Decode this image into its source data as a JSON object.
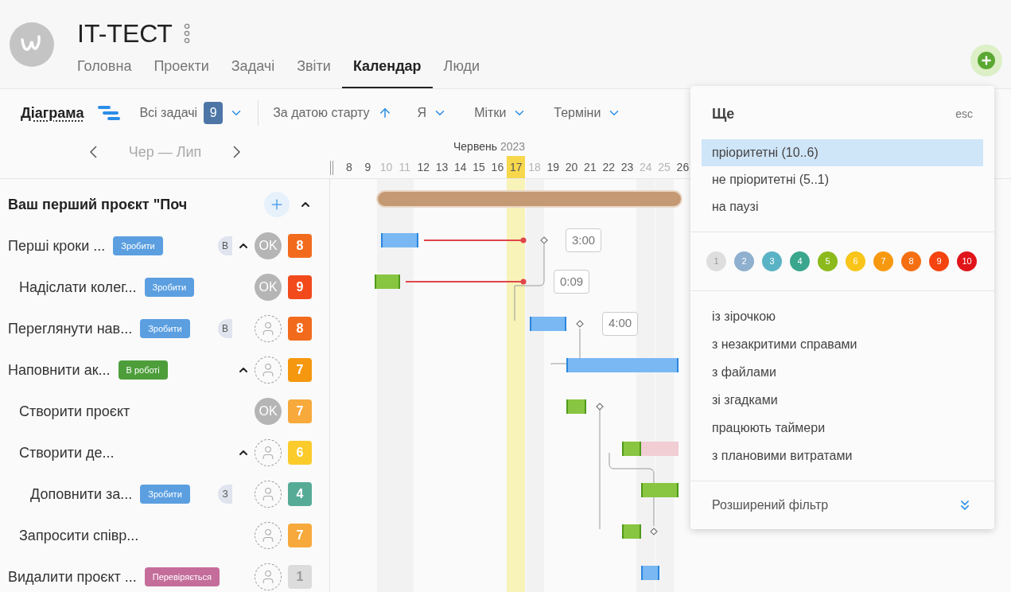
{
  "header": {
    "title": "IT-ТЕСТ",
    "nav": [
      {
        "label": "Головна",
        "selected": false
      },
      {
        "label": "Проекти",
        "selected": false
      },
      {
        "label": "Задачі",
        "selected": false
      },
      {
        "label": "Звіти",
        "selected": false
      },
      {
        "label": "Календар",
        "selected": true
      },
      {
        "label": "Люди",
        "selected": false
      }
    ]
  },
  "toolbar": {
    "view": {
      "label": "Діаграма",
      "selected": true
    },
    "filter": "Всі задачі",
    "count": "9",
    "sort": "За датою старту",
    "user": "Я",
    "labels": "Мітки",
    "deadlines": "Терміни"
  },
  "timeline": {
    "range": "Чер — Лип",
    "month": "Червень",
    "year": "2023",
    "days": [
      {
        "label": "8",
        "weekend": false,
        "today": false
      },
      {
        "label": "9",
        "weekend": false,
        "today": false
      },
      {
        "label": "10",
        "weekend": true,
        "today": false
      },
      {
        "label": "11",
        "weekend": true,
        "today": false
      },
      {
        "label": "12",
        "weekend": false,
        "today": false
      },
      {
        "label": "13",
        "weekend": false,
        "today": false
      },
      {
        "label": "14",
        "weekend": false,
        "today": false
      },
      {
        "label": "15",
        "weekend": false,
        "today": false
      },
      {
        "label": "16",
        "weekend": false,
        "today": false
      },
      {
        "label": "17",
        "weekend": false,
        "today": true
      },
      {
        "label": "18",
        "weekend": true,
        "today": false
      },
      {
        "label": "19",
        "weekend": false,
        "today": false
      },
      {
        "label": "20",
        "weekend": false,
        "today": false
      },
      {
        "label": "21",
        "weekend": false,
        "today": false
      },
      {
        "label": "22",
        "weekend": false,
        "today": false
      },
      {
        "label": "23",
        "weekend": false,
        "today": false
      },
      {
        "label": "24",
        "weekend": true,
        "today": false
      },
      {
        "label": "25",
        "weekend": true,
        "today": false
      },
      {
        "label": "26",
        "weekend": false,
        "today": false
      }
    ]
  },
  "project": {
    "name": "Ваш перший проєкт \"Поч",
    "expanded": true,
    "tasks": [
      {
        "name": "Перші кроки ...",
        "status": {
          "label": "Зробити",
          "color": "#5b9fe0"
        },
        "chip": "В",
        "expanded": true,
        "avatar": {
          "kind": "initials",
          "text": "OK"
        },
        "priority": {
          "label": "8",
          "color": "#f26b1d"
        },
        "duration": "3:00",
        "children": [
          {
            "name": "Надіслати колег...",
            "status": {
              "label": "Зробити",
              "color": "#5b9fe0"
            },
            "avatar": {
              "kind": "initials",
              "text": "OK"
            },
            "priority": {
              "label": "9",
              "color": "#f24a1b"
            },
            "duration": "0:09"
          }
        ]
      },
      {
        "name": "Переглянути нав...",
        "status": {
          "label": "Зробити",
          "color": "#5b9fe0"
        },
        "chip": "В",
        "avatar": {
          "kind": "unassigned"
        },
        "priority": {
          "label": "8",
          "color": "#f26b1d"
        },
        "duration": "4:00"
      },
      {
        "name": "Наповнити ак...",
        "status": {
          "label": "В роботі",
          "color": "#4d9e3a"
        },
        "expanded": true,
        "avatar": {
          "kind": "unassigned"
        },
        "priority": {
          "label": "7",
          "color": "#f5980f"
        },
        "children": [
          {
            "name": "Створити проєкт",
            "avatar": {
              "kind": "initials",
              "text": "OK"
            },
            "priority": {
              "label": "7",
              "color": "#f7a93b"
            }
          },
          {
            "name": "Створити де...",
            "expanded": true,
            "avatar": {
              "kind": "unassigned"
            },
            "priority": {
              "label": "6",
              "color": "#fbcb2c"
            },
            "children": [
              {
                "name": "Доповнити за...",
                "status": {
                  "label": "Зробити",
                  "color": "#5b9fe0"
                },
                "chip": "З",
                "avatar": {
                  "kind": "unassigned"
                },
                "priority": {
                  "label": "4",
                  "color": "#55ab96"
                }
              }
            ]
          },
          {
            "name": "Запросити співр...",
            "avatar": {
              "kind": "unassigned"
            },
            "priority": {
              "label": "7",
              "color": "#f7a93b"
            }
          }
        ]
      },
      {
        "name": "Видалити проєкт ...",
        "status": {
          "label": "Перевіряється",
          "color": "#c46d9b"
        },
        "avatar": {
          "kind": "unassigned"
        },
        "priority": {
          "label": "1",
          "color": "#dcdcdc"
        }
      }
    ]
  },
  "popup": {
    "title": "Ще",
    "close": "esc",
    "priority_filters": [
      {
        "label": "пріоритетні (10..6)",
        "selected": true
      },
      {
        "label": "не пріоритетні (5..1)",
        "selected": false
      },
      {
        "label": "на паузі",
        "selected": false
      }
    ],
    "priority_dots": [
      {
        "label": "1",
        "color": "#dedede"
      },
      {
        "label": "2",
        "color": "#8fb0cf"
      },
      {
        "label": "3",
        "color": "#5ab3c4"
      },
      {
        "label": "4",
        "color": "#3aa68e"
      },
      {
        "label": "5",
        "color": "#8cba1c"
      },
      {
        "label": "6",
        "color": "#f8c518"
      },
      {
        "label": "7",
        "color": "#f7990f"
      },
      {
        "label": "8",
        "color": "#f56f12"
      },
      {
        "label": "9",
        "color": "#f5440f"
      },
      {
        "label": "10",
        "color": "#e0141a"
      }
    ],
    "options": [
      "із зірочкою",
      "з незакритими справами",
      "з файлами",
      "зі згадками",
      "працюють таймери",
      "з плановими витратами"
    ],
    "advanced": "Розширений фільтр"
  }
}
